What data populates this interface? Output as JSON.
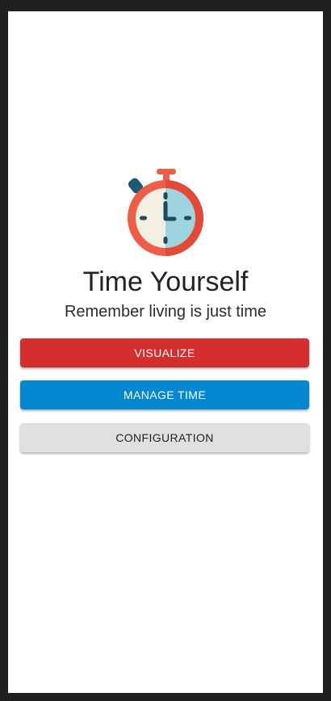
{
  "app": {
    "title": "Time Yourself",
    "subtitle": "Remember living is just time"
  },
  "logo": {
    "icon": "stopwatch-icon",
    "colors": {
      "ring": "#ee5d45",
      "left_face": "#f4efe3",
      "right_face": "#9fd3df",
      "hands": "#1d4a5e",
      "button": "#1d5a70"
    }
  },
  "buttons": {
    "visualize": {
      "label": "VISUALIZE",
      "color": "#d32f2f"
    },
    "manage_time": {
      "label": "MANAGE TIME",
      "color": "#0288d1"
    },
    "configuration": {
      "label": "CONFIGURATION",
      "color": "#e0e0e0"
    }
  }
}
